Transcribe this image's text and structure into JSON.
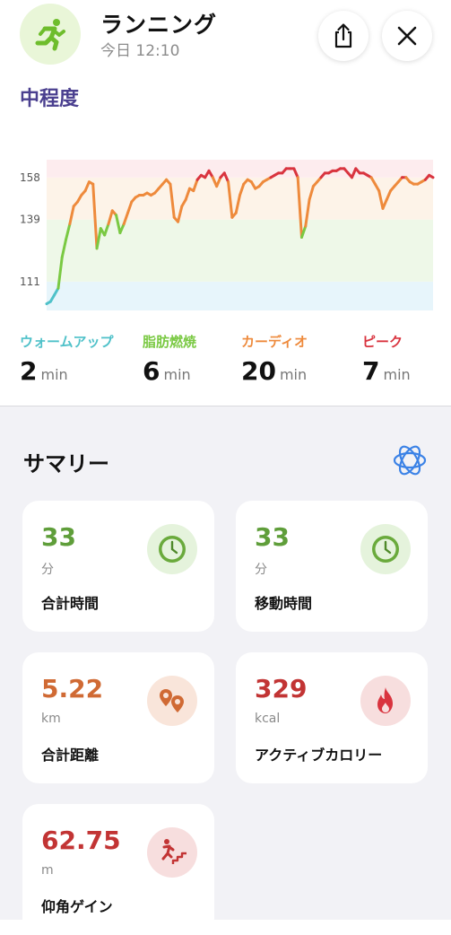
{
  "header": {
    "title": "ランニング",
    "subtitle": "今日 12:10",
    "activity_icon": "running-person-icon",
    "share_icon": "share-icon",
    "close_icon": "close-icon"
  },
  "intensity_label": "中程度",
  "chart_data": {
    "type": "line",
    "title": "",
    "xlabel": "",
    "ylabel": "",
    "y_ticks": [
      158,
      139,
      111
    ],
    "ylim": [
      98,
      166
    ],
    "x": [
      0,
      1,
      2,
      3,
      4,
      5,
      6,
      7,
      8,
      9,
      10,
      11,
      12,
      13,
      14,
      15,
      16,
      17,
      18,
      19,
      20,
      21,
      22,
      23,
      24,
      25,
      26,
      27,
      28,
      29,
      30,
      31,
      32,
      33,
      34,
      35,
      36,
      37,
      38,
      39,
      40,
      41,
      42,
      43,
      44,
      45,
      46,
      47,
      48,
      49,
      50,
      51,
      52,
      53,
      54,
      55,
      56,
      57,
      58,
      59,
      60,
      61,
      62,
      63,
      64,
      65,
      66,
      67,
      68,
      69,
      70,
      71,
      72,
      73,
      74,
      75,
      76,
      77,
      78,
      79,
      80,
      81,
      82,
      83,
      84,
      85,
      86,
      87,
      88,
      89,
      90,
      91,
      92,
      93,
      94,
      95,
      96,
      97,
      98,
      99,
      100
    ],
    "values": [
      101,
      102,
      105,
      108,
      122,
      130,
      137,
      145,
      147,
      150,
      152,
      156,
      155,
      126,
      135,
      132,
      137,
      143,
      141,
      133,
      137,
      142,
      147,
      149,
      150,
      150,
      151,
      150,
      151,
      153,
      155,
      157,
      155,
      140,
      138,
      145,
      148,
      153,
      152,
      157,
      159,
      158,
      161,
      158,
      154,
      158,
      160,
      156,
      140,
      142,
      150,
      155,
      157,
      156,
      153,
      154,
      156,
      157,
      158,
      159,
      160,
      160,
      162,
      162,
      162,
      158,
      131,
      136,
      148,
      154,
      156,
      158,
      160,
      160,
      161,
      161,
      162,
      162,
      160,
      158,
      162,
      160,
      160,
      159,
      158,
      155,
      152,
      144,
      148,
      152,
      154,
      156,
      158,
      158,
      156,
      155,
      155,
      156,
      157,
      159,
      158
    ],
    "zones": [
      {
        "name": "warmup",
        "from": 98,
        "to": 111,
        "color": "#e7f5fb"
      },
      {
        "name": "fatburn",
        "from": 111,
        "to": 139,
        "color": "#eef8e8"
      },
      {
        "name": "cardio",
        "from": 139,
        "to": 158,
        "color": "#fdf3e8"
      },
      {
        "name": "peak",
        "from": 158,
        "to": 166,
        "color": "#fdecee"
      }
    ],
    "grid": false,
    "legend": "none"
  },
  "zones": [
    {
      "name": "ウォームアップ",
      "value": "2",
      "unit": "min",
      "color": "#4fc1c9"
    },
    {
      "name": "脂肪燃焼",
      "value": "6",
      "unit": "min",
      "color": "#7ac943"
    },
    {
      "name": "カーディオ",
      "value": "20",
      "unit": "min",
      "color": "#ee8a3c"
    },
    {
      "name": "ピーク",
      "value": "7",
      "unit": "min",
      "color": "#d9343f"
    }
  ],
  "summary": {
    "title": "サマリー",
    "ai_icon": "atom-icon",
    "cards": [
      {
        "value": "33",
        "unit": "分",
        "label": "合計時間",
        "color": "#5f9e3a",
        "badge_bg": "#e5f3dc",
        "icon": "clock-icon"
      },
      {
        "value": "33",
        "unit": "分",
        "label": "移動時間",
        "color": "#5f9e3a",
        "badge_bg": "#e5f3dc",
        "icon": "clock-icon"
      },
      {
        "value": "5.22",
        "unit": "km",
        "label": "合計距離",
        "color": "#d06a34",
        "badge_bg": "#f9e5da",
        "icon": "location-pins-icon"
      },
      {
        "value": "329",
        "unit": "kcal",
        "label": "アクティブカロリー",
        "color": "#c23434",
        "badge_bg": "#f7dede",
        "icon": "flame-icon"
      },
      {
        "value": "62.75",
        "unit": "m",
        "label": "仰角ゲイン",
        "color": "#c23434",
        "badge_bg": "#f7dede",
        "icon": "stairs-climb-icon"
      }
    ]
  }
}
